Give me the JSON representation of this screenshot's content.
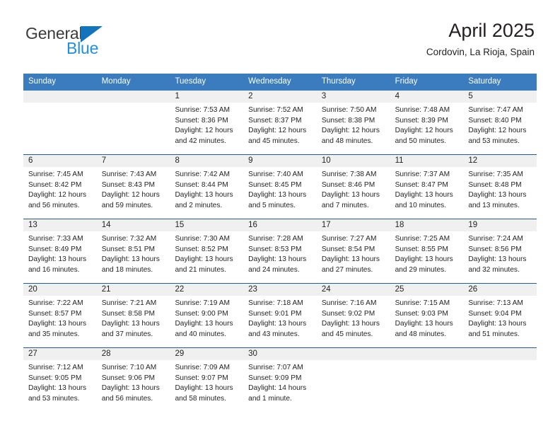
{
  "brand": {
    "name_part1": "General",
    "name_part2": "Blue",
    "triangle_icon": "triangle-icon",
    "accent_dark": "#3b3b3b",
    "accent_blue": "#1f8fe0",
    "triangle_blue": "#1274bc"
  },
  "header": {
    "title": "April 2025",
    "subtitle": "Cordovin, La Rioja, Spain"
  },
  "calendar": {
    "header_bg": "#3a7cbe",
    "row_divider": "#1c5e9e",
    "number_band_bg": "#f0f0f0",
    "weekdays": [
      "Sunday",
      "Monday",
      "Tuesday",
      "Wednesday",
      "Thursday",
      "Friday",
      "Saturday"
    ],
    "weeks": [
      {
        "days": [
          {
            "num": "",
            "lines": [
              "",
              "",
              "",
              ""
            ]
          },
          {
            "num": "",
            "lines": [
              "",
              "",
              "",
              ""
            ]
          },
          {
            "num": "1",
            "lines": [
              "Sunrise: 7:53 AM",
              "Sunset: 8:36 PM",
              "Daylight: 12 hours",
              "and 42 minutes."
            ]
          },
          {
            "num": "2",
            "lines": [
              "Sunrise: 7:52 AM",
              "Sunset: 8:37 PM",
              "Daylight: 12 hours",
              "and 45 minutes."
            ]
          },
          {
            "num": "3",
            "lines": [
              "Sunrise: 7:50 AM",
              "Sunset: 8:38 PM",
              "Daylight: 12 hours",
              "and 48 minutes."
            ]
          },
          {
            "num": "4",
            "lines": [
              "Sunrise: 7:48 AM",
              "Sunset: 8:39 PM",
              "Daylight: 12 hours",
              "and 50 minutes."
            ]
          },
          {
            "num": "5",
            "lines": [
              "Sunrise: 7:47 AM",
              "Sunset: 8:40 PM",
              "Daylight: 12 hours",
              "and 53 minutes."
            ]
          }
        ]
      },
      {
        "days": [
          {
            "num": "6",
            "lines": [
              "Sunrise: 7:45 AM",
              "Sunset: 8:42 PM",
              "Daylight: 12 hours",
              "and 56 minutes."
            ]
          },
          {
            "num": "7",
            "lines": [
              "Sunrise: 7:43 AM",
              "Sunset: 8:43 PM",
              "Daylight: 12 hours",
              "and 59 minutes."
            ]
          },
          {
            "num": "8",
            "lines": [
              "Sunrise: 7:42 AM",
              "Sunset: 8:44 PM",
              "Daylight: 13 hours",
              "and 2 minutes."
            ]
          },
          {
            "num": "9",
            "lines": [
              "Sunrise: 7:40 AM",
              "Sunset: 8:45 PM",
              "Daylight: 13 hours",
              "and 5 minutes."
            ]
          },
          {
            "num": "10",
            "lines": [
              "Sunrise: 7:38 AM",
              "Sunset: 8:46 PM",
              "Daylight: 13 hours",
              "and 7 minutes."
            ]
          },
          {
            "num": "11",
            "lines": [
              "Sunrise: 7:37 AM",
              "Sunset: 8:47 PM",
              "Daylight: 13 hours",
              "and 10 minutes."
            ]
          },
          {
            "num": "12",
            "lines": [
              "Sunrise: 7:35 AM",
              "Sunset: 8:48 PM",
              "Daylight: 13 hours",
              "and 13 minutes."
            ]
          }
        ]
      },
      {
        "days": [
          {
            "num": "13",
            "lines": [
              "Sunrise: 7:33 AM",
              "Sunset: 8:49 PM",
              "Daylight: 13 hours",
              "and 16 minutes."
            ]
          },
          {
            "num": "14",
            "lines": [
              "Sunrise: 7:32 AM",
              "Sunset: 8:51 PM",
              "Daylight: 13 hours",
              "and 18 minutes."
            ]
          },
          {
            "num": "15",
            "lines": [
              "Sunrise: 7:30 AM",
              "Sunset: 8:52 PM",
              "Daylight: 13 hours",
              "and 21 minutes."
            ]
          },
          {
            "num": "16",
            "lines": [
              "Sunrise: 7:28 AM",
              "Sunset: 8:53 PM",
              "Daylight: 13 hours",
              "and 24 minutes."
            ]
          },
          {
            "num": "17",
            "lines": [
              "Sunrise: 7:27 AM",
              "Sunset: 8:54 PM",
              "Daylight: 13 hours",
              "and 27 minutes."
            ]
          },
          {
            "num": "18",
            "lines": [
              "Sunrise: 7:25 AM",
              "Sunset: 8:55 PM",
              "Daylight: 13 hours",
              "and 29 minutes."
            ]
          },
          {
            "num": "19",
            "lines": [
              "Sunrise: 7:24 AM",
              "Sunset: 8:56 PM",
              "Daylight: 13 hours",
              "and 32 minutes."
            ]
          }
        ]
      },
      {
        "days": [
          {
            "num": "20",
            "lines": [
              "Sunrise: 7:22 AM",
              "Sunset: 8:57 PM",
              "Daylight: 13 hours",
              "and 35 minutes."
            ]
          },
          {
            "num": "21",
            "lines": [
              "Sunrise: 7:21 AM",
              "Sunset: 8:58 PM",
              "Daylight: 13 hours",
              "and 37 minutes."
            ]
          },
          {
            "num": "22",
            "lines": [
              "Sunrise: 7:19 AM",
              "Sunset: 9:00 PM",
              "Daylight: 13 hours",
              "and 40 minutes."
            ]
          },
          {
            "num": "23",
            "lines": [
              "Sunrise: 7:18 AM",
              "Sunset: 9:01 PM",
              "Daylight: 13 hours",
              "and 43 minutes."
            ]
          },
          {
            "num": "24",
            "lines": [
              "Sunrise: 7:16 AM",
              "Sunset: 9:02 PM",
              "Daylight: 13 hours",
              "and 45 minutes."
            ]
          },
          {
            "num": "25",
            "lines": [
              "Sunrise: 7:15 AM",
              "Sunset: 9:03 PM",
              "Daylight: 13 hours",
              "and 48 minutes."
            ]
          },
          {
            "num": "26",
            "lines": [
              "Sunrise: 7:13 AM",
              "Sunset: 9:04 PM",
              "Daylight: 13 hours",
              "and 51 minutes."
            ]
          }
        ]
      },
      {
        "days": [
          {
            "num": "27",
            "lines": [
              "Sunrise: 7:12 AM",
              "Sunset: 9:05 PM",
              "Daylight: 13 hours",
              "and 53 minutes."
            ]
          },
          {
            "num": "28",
            "lines": [
              "Sunrise: 7:10 AM",
              "Sunset: 9:06 PM",
              "Daylight: 13 hours",
              "and 56 minutes."
            ]
          },
          {
            "num": "29",
            "lines": [
              "Sunrise: 7:09 AM",
              "Sunset: 9:07 PM",
              "Daylight: 13 hours",
              "and 58 minutes."
            ]
          },
          {
            "num": "30",
            "lines": [
              "Sunrise: 7:07 AM",
              "Sunset: 9:09 PM",
              "Daylight: 14 hours",
              "and 1 minute."
            ]
          },
          {
            "num": "",
            "lines": [
              "",
              "",
              "",
              ""
            ]
          },
          {
            "num": "",
            "lines": [
              "",
              "",
              "",
              ""
            ]
          },
          {
            "num": "",
            "lines": [
              "",
              "",
              "",
              ""
            ]
          }
        ]
      }
    ]
  }
}
